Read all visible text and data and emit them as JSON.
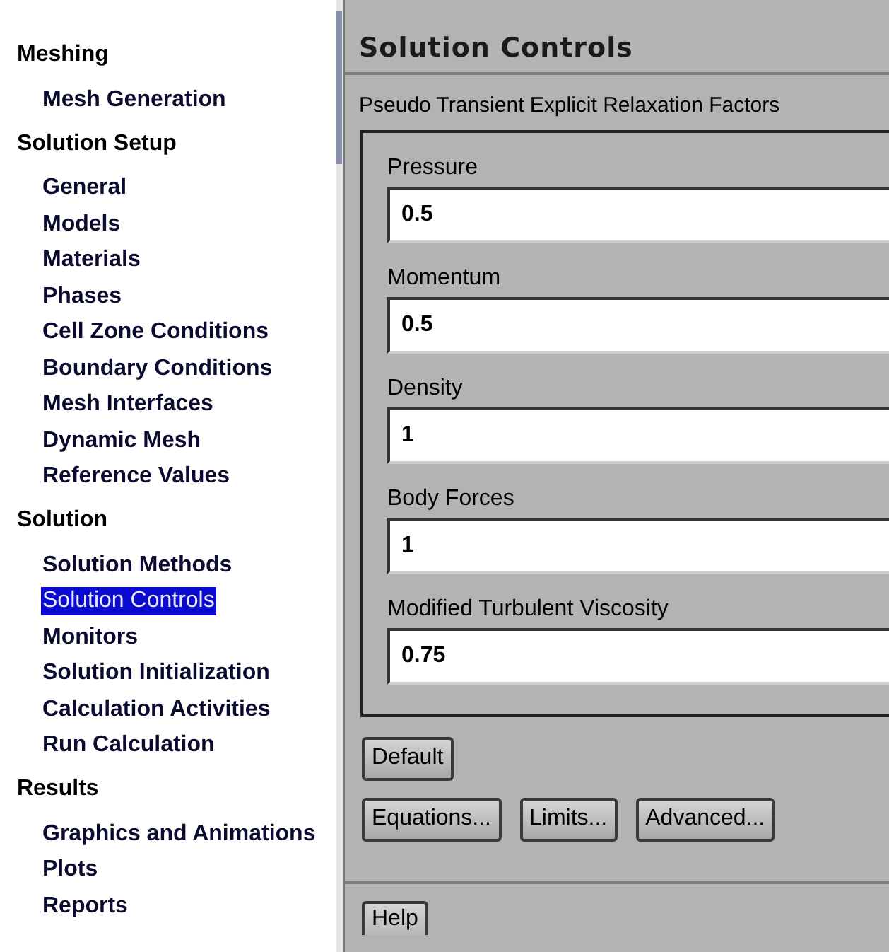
{
  "tree": [
    {
      "label": "Meshing",
      "children": [
        {
          "label": "Mesh Generation",
          "selected": false
        }
      ]
    },
    {
      "label": "Solution Setup",
      "children": [
        {
          "label": "General",
          "selected": false
        },
        {
          "label": "Models",
          "selected": false
        },
        {
          "label": "Materials",
          "selected": false
        },
        {
          "label": "Phases",
          "selected": false
        },
        {
          "label": "Cell Zone Conditions",
          "selected": false
        },
        {
          "label": "Boundary Conditions",
          "selected": false
        },
        {
          "label": "Mesh Interfaces",
          "selected": false
        },
        {
          "label": "Dynamic Mesh",
          "selected": false
        },
        {
          "label": "Reference Values",
          "selected": false
        }
      ]
    },
    {
      "label": "Solution",
      "children": [
        {
          "label": "Solution Methods",
          "selected": false
        },
        {
          "label": "Solution Controls",
          "selected": true
        },
        {
          "label": "Monitors",
          "selected": false
        },
        {
          "label": "Solution Initialization",
          "selected": false
        },
        {
          "label": "Calculation Activities",
          "selected": false
        },
        {
          "label": "Run Calculation",
          "selected": false
        }
      ]
    },
    {
      "label": "Results",
      "children": [
        {
          "label": "Graphics and Animations",
          "selected": false
        },
        {
          "label": "Plots",
          "selected": false
        },
        {
          "label": "Reports",
          "selected": false
        }
      ]
    }
  ],
  "panel": {
    "title": "Solution Controls",
    "group": {
      "label": "Pseudo Transient Explicit Relaxation Factors",
      "fields": [
        {
          "label": "Pressure",
          "value": "0.5"
        },
        {
          "label": "Momentum",
          "value": "0.5"
        },
        {
          "label": "Density",
          "value": "1"
        },
        {
          "label": "Body Forces",
          "value": "1"
        },
        {
          "label": "Modified Turbulent Viscosity",
          "value": "0.75"
        }
      ]
    },
    "button_rows": [
      {
        "buttons": [
          "Default"
        ]
      },
      {
        "buttons": [
          "Equations...",
          "Limits...",
          "Advanced..."
        ]
      }
    ],
    "help_button": "Help"
  }
}
